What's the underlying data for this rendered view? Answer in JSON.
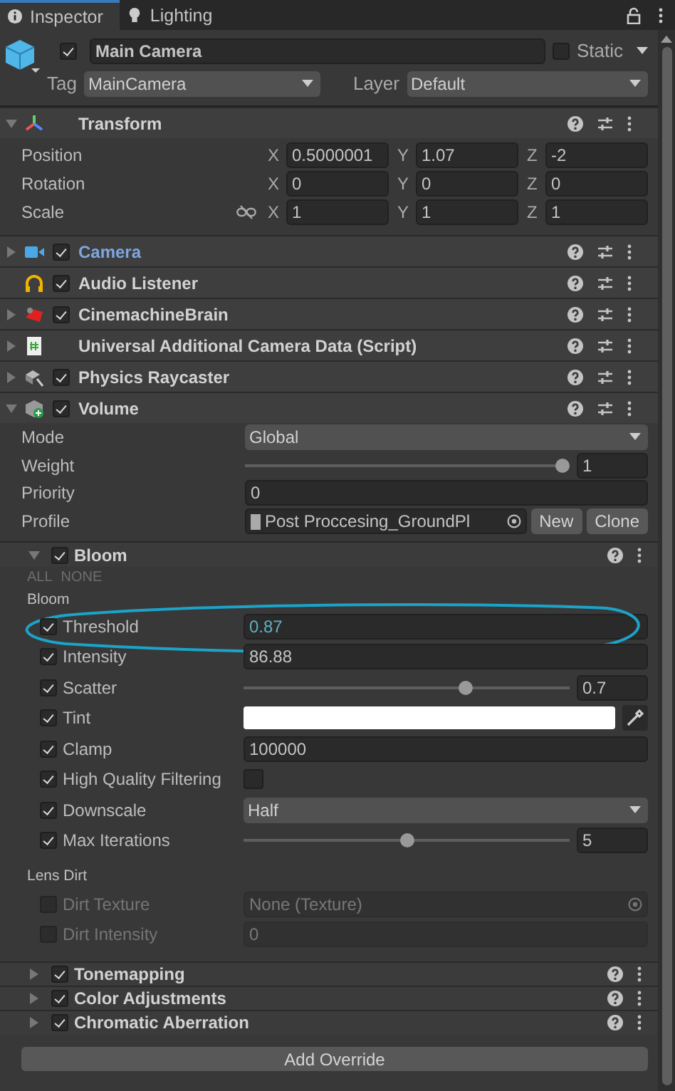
{
  "tabs": [
    {
      "label": "Inspector",
      "selected": true
    },
    {
      "label": "Lighting",
      "selected": false
    }
  ],
  "object": {
    "active": true,
    "name": "Main Camera",
    "static": false,
    "static_label": "Static",
    "tag_label": "Tag",
    "tag": "MainCamera",
    "layer_label": "Layer",
    "layer": "Default"
  },
  "components": [
    {
      "kind": "transform",
      "name": "Transform",
      "expanded": true,
      "overridden": false,
      "rows": [
        {
          "label": "Position",
          "constraint_icon": false,
          "axes": [
            {
              "axis": "X",
              "value": "0.5000001"
            },
            {
              "axis": "Y",
              "value": "1.07"
            },
            {
              "axis": "Z",
              "value": "-2"
            }
          ]
        },
        {
          "label": "Rotation",
          "constraint_icon": false,
          "axes": [
            {
              "axis": "X",
              "value": "0"
            },
            {
              "axis": "Y",
              "value": "0"
            },
            {
              "axis": "Z",
              "value": "0"
            }
          ]
        },
        {
          "label": "Scale",
          "constraint_icon": true,
          "axes": [
            {
              "axis": "X",
              "value": "1"
            },
            {
              "axis": "Y",
              "value": "1"
            },
            {
              "axis": "Z",
              "value": "1"
            }
          ]
        }
      ]
    },
    {
      "name": "Camera",
      "expanded": false,
      "enabled": true,
      "overridden": true
    },
    {
      "name": "Audio Listener",
      "enabled": true,
      "overridden": false
    },
    {
      "name": "CinemachineBrain",
      "expanded": false,
      "enabled": true,
      "overridden": false
    },
    {
      "name": "Universal Additional Camera Data (Script)",
      "expanded": false,
      "overridden": false
    },
    {
      "name": "Physics Raycaster",
      "expanded": false,
      "enabled": true,
      "overridden": false
    },
    {
      "kind": "volume",
      "name": "Volume",
      "expanded": true,
      "enabled": true,
      "overridden": false,
      "properties": [
        {
          "label": "Mode",
          "kind": "dropdown",
          "value": "Global"
        },
        {
          "label": "Weight",
          "kind": "slider",
          "level": 1,
          "value": "1"
        },
        {
          "label": "Priority",
          "kind": "field",
          "value": "0"
        },
        {
          "label": "Profile",
          "kind": "object",
          "value": "Post Proccesing_GroundPl",
          "buttons": [
            "New",
            "Clone"
          ]
        }
      ],
      "overrides": [
        {
          "name": "Bloom",
          "enabled": true,
          "expanded": true,
          "toggles": [
            "ALL",
            "NONE"
          ],
          "sections": [
            {
              "title": "Bloom",
              "params": [
                {
                  "label": "Threshold",
                  "override": true,
                  "kind": "field",
                  "value": "0.87",
                  "focused": true,
                  "circled": true
                },
                {
                  "label": "Intensity",
                  "override": true,
                  "kind": "field",
                  "value": "86.88",
                  "focused": false,
                  "circled": false
                },
                {
                  "label": "Scatter",
                  "override": true,
                  "kind": "slider",
                  "level": 0.69,
                  "value": "0.7",
                  "circled": false
                },
                {
                  "label": "Tint",
                  "override": true,
                  "kind": "color",
                  "color": "#ffffff",
                  "circled": false
                },
                {
                  "label": "Clamp",
                  "override": true,
                  "kind": "field",
                  "value": "100000",
                  "focused": false,
                  "circled": false
                },
                {
                  "label": "High Quality Filtering",
                  "override": true,
                  "kind": "checkbox",
                  "checked": false,
                  "circled": false
                },
                {
                  "label": "Downscale",
                  "override": true,
                  "kind": "dropdown",
                  "value": "Half",
                  "circled": false
                },
                {
                  "label": "Max Iterations",
                  "override": true,
                  "kind": "slider",
                  "level": 0.5,
                  "value": "5",
                  "circled": false
                }
              ]
            },
            {
              "title": "Lens Dirt",
              "params": [
                {
                  "label": "Dirt Texture",
                  "override": false,
                  "kind": "object",
                  "value": "None (Texture)",
                  "circled": false
                },
                {
                  "label": "Dirt Intensity",
                  "override": false,
                  "kind": "field",
                  "value": "0",
                  "focused": false,
                  "circled": false
                }
              ]
            }
          ]
        },
        {
          "name": "Tonemapping",
          "enabled": true,
          "expanded": false
        },
        {
          "name": "Color Adjustments",
          "enabled": true,
          "expanded": false
        },
        {
          "name": "Chromatic Aberration",
          "enabled": true,
          "expanded": false
        }
      ],
      "add_button": "Add Override"
    }
  ]
}
